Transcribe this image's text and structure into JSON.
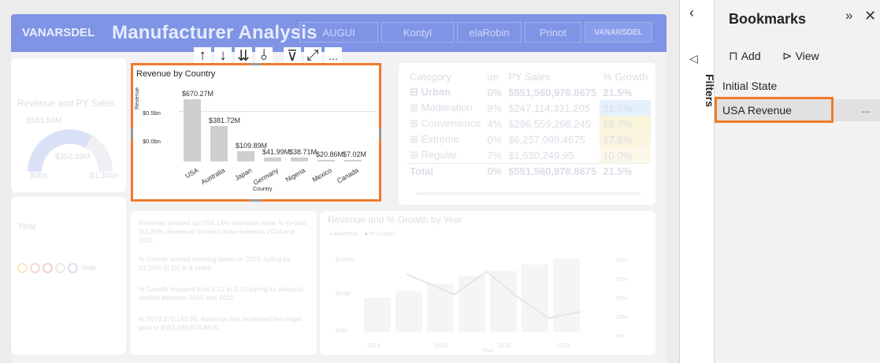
{
  "report": {
    "logo": "VANARSDEL",
    "title": "Manufacturer Analysis",
    "header_tabs": [
      "AUGUI",
      "Kontyl",
      "elaRobin",
      "Prinot"
    ],
    "header_logo_right": "VANARSDEL"
  },
  "gauge": {
    "title": "Revenue and PY Sales",
    "top_value": "$551.56M",
    "mid_value": "$352.29M",
    "min": "$0bn",
    "max": "$1.34bn"
  },
  "year_slicer": {
    "title": "Year",
    "label": "Year"
  },
  "visual_toolbar": {
    "icons": [
      "arrow-up-icon",
      "arrow-down-icon",
      "double-arrow-down-icon",
      "expand-hierarchy-icon",
      "filter-icon",
      "focus-mode-icon",
      "more-options-icon"
    ],
    "more": "..."
  },
  "revenue_chart": {
    "y_axis_label": "Revenue",
    "x_axis_label": "Country",
    "y_ticks": [
      "$0.5bn",
      "$0.0bn"
    ]
  },
  "chart_data": {
    "type": "bar",
    "title": "Revenue by Country",
    "xlabel": "Country",
    "ylabel": "Revenue",
    "categories": [
      "USA",
      "Australia",
      "Japan",
      "Germany",
      "Nigeria",
      "Mexico",
      "Canada"
    ],
    "values": [
      670.27,
      381.72,
      109.89,
      41.99,
      38.71,
      20.86,
      7.02
    ],
    "value_labels": [
      "$670.27M",
      "$381.72M",
      "$109.89M",
      "$41.99M",
      "$38.71M",
      "$20.86M",
      "$7.02M"
    ],
    "unit": "M",
    "ylim": [
      0,
      750
    ],
    "grid": true
  },
  "category_table": {
    "headers": [
      "Category",
      "ue",
      "PY Sales",
      "% Growth"
    ],
    "rows": [
      [
        "Urban",
        "0%",
        "$551,560,978.8675",
        "21.5%"
      ],
      [
        "Moderation",
        "9%",
        "$247,114,331.205",
        "21.5%"
      ],
      [
        "Convenience",
        "4%",
        "$296,559,298.245",
        "19.7%"
      ],
      [
        "Extreme",
        "0%",
        "$6,257,099.4675",
        "17.6%"
      ],
      [
        "Regular",
        "7%",
        "$1,630,249.95",
        "10.0%"
      ]
    ],
    "total": [
      "Total",
      "0%",
      "$551,560,978.8675",
      "21.5%"
    ],
    "colors": {
      "row1_growth": "#d6e8fb",
      "row2_growth": "#f4f0c8",
      "row3_growth": "#f7eecf",
      "row4_growth": "#faf4dd"
    }
  },
  "narrative": {
    "p1": "Revenue trended up (754.14% increase) while % Growth (53.20% decrease) trended down between 2014 and 2021.",
    "p2": "% Growth started trending down on 2015, falling by 53.20% (0.11) in 6 years.",
    "p3": "% Growth dropped from 0.21 to 0.10 during its steepest decline between 2015 and 2021.",
    "p4": "At $670,270,149.99, Revenue has exceeded the target goal of $551,560,978.8675."
  },
  "combo_chart": {
    "title": "Revenue and % Growth by Year",
    "legend": [
      "Revenue",
      "% Growth"
    ],
    "y_left": [
      "$100M",
      "$50M",
      "$0M"
    ],
    "y_right": [
      "25%",
      "20%",
      "15%",
      "10%",
      "5%"
    ],
    "x_ticks": [
      "2014",
      "2016",
      "2018",
      "2020"
    ],
    "x_label": "Year",
    "y_label": "Revenue",
    "y_right_label": "% Growth"
  },
  "filters_pane": {
    "label": "Filters"
  },
  "bookmarks": {
    "title": "Bookmarks",
    "add_label": "Add",
    "view_label": "View",
    "items": [
      "Initial State",
      "USA Revenue"
    ],
    "selected_more": "...",
    "accent": "#f07a2a"
  }
}
